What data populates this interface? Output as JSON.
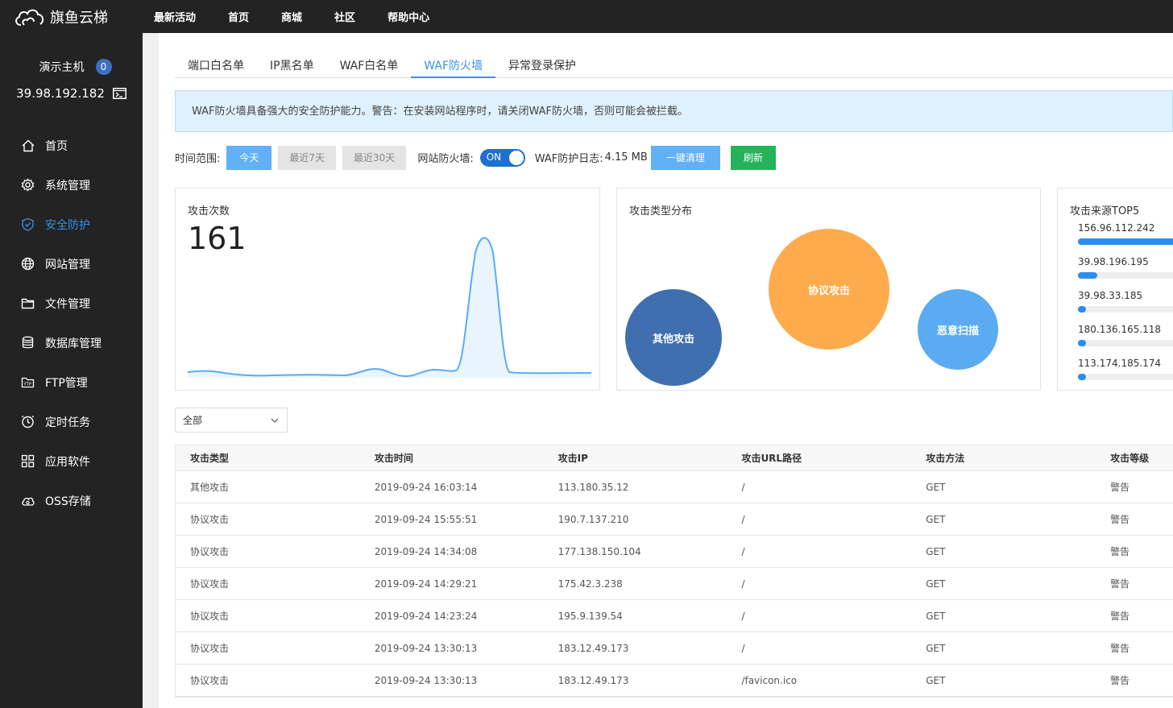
{
  "brand": {
    "name": "旗鱼云梯"
  },
  "topnav": [
    "最新活动",
    "首页",
    "商城",
    "社区",
    "帮助中心"
  ],
  "host": {
    "name": "演示主机",
    "badge": "0",
    "ip": "39.98.192.182"
  },
  "sidebar": {
    "items": [
      {
        "label": "首页",
        "icon": "home-icon"
      },
      {
        "label": "系统管理",
        "icon": "gear-icon"
      },
      {
        "label": "安全防护",
        "icon": "shield-icon",
        "active": true
      },
      {
        "label": "网站管理",
        "icon": "globe-icon"
      },
      {
        "label": "文件管理",
        "icon": "folder-icon"
      },
      {
        "label": "数据库管理",
        "icon": "database-icon"
      },
      {
        "label": "FTP管理",
        "icon": "ftp-icon"
      },
      {
        "label": "定时任务",
        "icon": "clock-icon"
      },
      {
        "label": "应用软件",
        "icon": "apps-icon"
      },
      {
        "label": "OSS存储",
        "icon": "cloud-icon"
      }
    ]
  },
  "tabs": [
    {
      "label": "端口白名单"
    },
    {
      "label": "IP黑名单"
    },
    {
      "label": "WAF白名单"
    },
    {
      "label": "WAF防火墙",
      "active": true
    },
    {
      "label": "异常登录保护"
    }
  ],
  "alert": "WAF防火墙具备强大的安全防护能力。警告：在安装网站程序时，请关闭WAF防火墙，否则可能会被拦截。",
  "toolbar": {
    "time_range_label": "时间范围:",
    "today": "今天",
    "last7": "最近7天",
    "last30": "最近30天",
    "firewall_label": "网站防火墙:",
    "firewall_state": "ON",
    "log_label": "WAF防护日志:",
    "log_size": "4.15 MB",
    "clear_label": "一键清理",
    "refresh_label": "刷新"
  },
  "attack_count": {
    "title": "攻击次数",
    "value": "161"
  },
  "attack_types": {
    "title": "攻击类型分布",
    "items": [
      {
        "name": "其他攻击",
        "color": "#3f6fae"
      },
      {
        "name": "协议攻击",
        "color": "#fdab4d"
      },
      {
        "name": "恶意扫描",
        "color": "#5aabf2"
      }
    ]
  },
  "top5": {
    "title": "攻击来源TOP5",
    "items": [
      {
        "ip": "156.96.112.242",
        "fraction": 1.0
      },
      {
        "ip": "39.98.196.195",
        "fraction": 0.17
      },
      {
        "ip": "39.98.33.185",
        "fraction": 0.07
      },
      {
        "ip": "180.136.165.118",
        "fraction": 0.07
      },
      {
        "ip": "113.174.185.174",
        "fraction": 0.07
      }
    ]
  },
  "filter": {
    "value": "全部"
  },
  "table": {
    "headers": [
      "攻击类型",
      "攻击时间",
      "攻击IP",
      "攻击URL路径",
      "攻击方法",
      "攻击等级"
    ],
    "rows": [
      [
        "其他攻击",
        "2019-09-24 16:03:14",
        "113.180.35.12",
        "/",
        "GET",
        "警告"
      ],
      [
        "协议攻击",
        "2019-09-24 15:55:51",
        "190.7.137.210",
        "/",
        "GET",
        "警告"
      ],
      [
        "协议攻击",
        "2019-09-24 14:34:08",
        "177.138.150.104",
        "/",
        "GET",
        "警告"
      ],
      [
        "协议攻击",
        "2019-09-24 14:29:21",
        "175.42.3.238",
        "/",
        "GET",
        "警告"
      ],
      [
        "协议攻击",
        "2019-09-24 14:23:24",
        "195.9.139.54",
        "/",
        "GET",
        "警告"
      ],
      [
        "协议攻击",
        "2019-09-24 13:30:13",
        "183.12.49.173",
        "/",
        "GET",
        "警告"
      ],
      [
        "协议攻击",
        "2019-09-24 13:30:13",
        "183.12.49.173",
        "/favicon.ico",
        "GET",
        "警告"
      ]
    ]
  }
}
